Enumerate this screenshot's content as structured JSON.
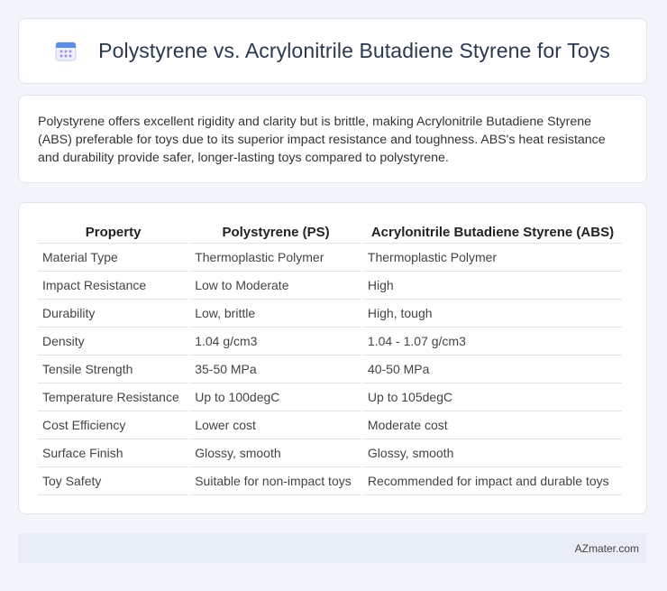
{
  "header": {
    "icon": "calendar-grid-icon",
    "title": "Polystyrene vs. Acrylonitrile Butadiene Styrene for Toys"
  },
  "summary": {
    "text": "Polystyrene offers excellent rigidity and clarity but is brittle, making Acrylonitrile Butadiene Styrene (ABS) preferable for toys due to its superior impact resistance and toughness. ABS's heat resistance and durability provide safer, longer-lasting toys compared to polystyrene."
  },
  "table": {
    "headers": [
      "Property",
      "Polystyrene (PS)",
      "Acrylonitrile Butadiene Styrene (ABS)"
    ],
    "rows": [
      [
        "Material Type",
        "Thermoplastic Polymer",
        "Thermoplastic Polymer"
      ],
      [
        "Impact Resistance",
        "Low to Moderate",
        "High"
      ],
      [
        "Durability",
        "Low, brittle",
        "High, tough"
      ],
      [
        "Density",
        "1.04 g/cm3",
        "1.04 - 1.07 g/cm3"
      ],
      [
        "Tensile Strength",
        "35-50 MPa",
        "40-50 MPa"
      ],
      [
        "Temperature Resistance",
        "Up to 100degC",
        "Up to 105degC"
      ],
      [
        "Cost Efficiency",
        "Lower cost",
        "Moderate cost"
      ],
      [
        "Surface Finish",
        "Glossy, smooth",
        "Glossy, smooth"
      ],
      [
        "Toy Safety",
        "Suitable for non-impact toys",
        "Recommended for impact and durable toys"
      ]
    ]
  },
  "footer": {
    "brand": "AZmater.com"
  },
  "colors": {
    "page_background": "#f2f5f9",
    "title_text": "#2a3850",
    "footer_background": "#e8edf7",
    "icon_blue": "#5b8def",
    "icon_purple": "#a78bfa"
  }
}
